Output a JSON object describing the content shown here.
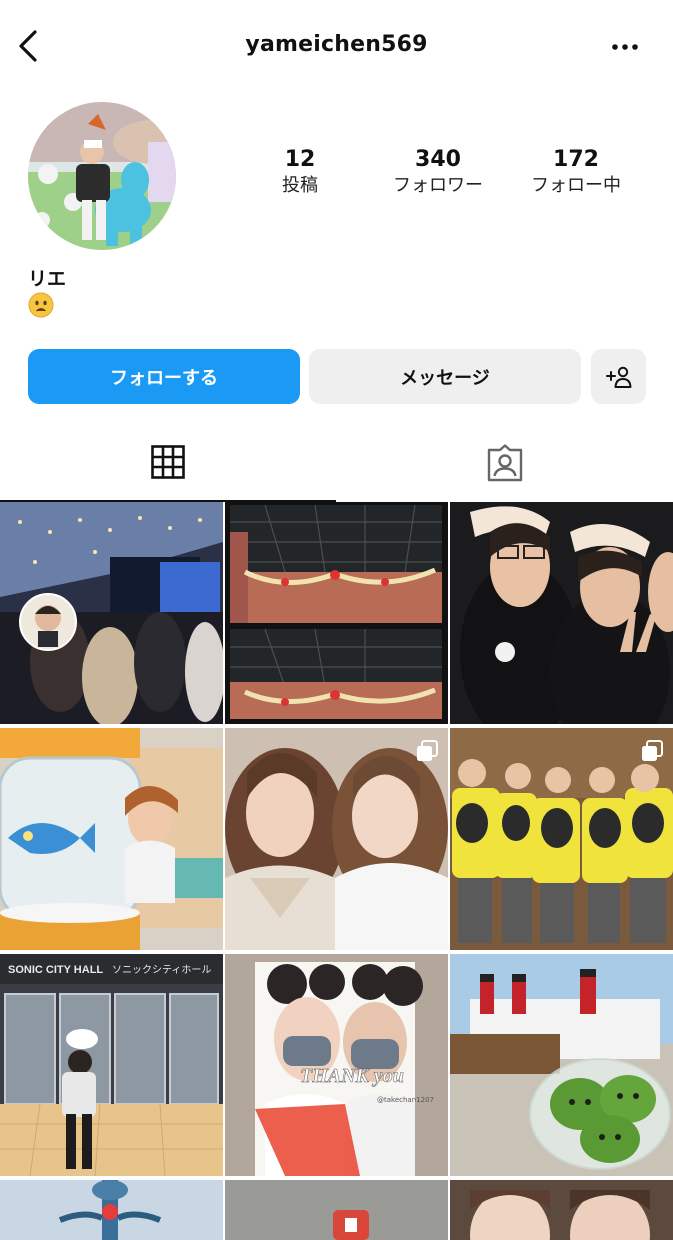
{
  "header": {
    "username": "yameichen569",
    "back_icon": "chevron-left-icon",
    "more_icon": "ellipsis-icon"
  },
  "profile": {
    "display_name": "リエ",
    "bio_emoji": "frowning-face-emoji",
    "stats": [
      {
        "key": "posts",
        "value": "12",
        "label": "投稿"
      },
      {
        "key": "followers",
        "value": "340",
        "label": "フォロワー"
      },
      {
        "key": "following",
        "value": "172",
        "label": "フォロー中"
      }
    ]
  },
  "actions": {
    "follow_label": "フォローする",
    "message_label": "メッセージ",
    "suggest_icon": "add-person-icon"
  },
  "tabs": [
    {
      "name": "posts-grid",
      "icon": "grid-icon",
      "active": true
    },
    {
      "name": "tagged",
      "icon": "tagged-person-icon",
      "active": false
    }
  ],
  "grid": {
    "tiles": [
      {
        "name": "photo-night-plaza"
      },
      {
        "name": "photo-christmas-garland-station"
      },
      {
        "name": "photo-friends-mickey-ears"
      },
      {
        "name": "photo-snow-globe-fish"
      },
      {
        "name": "photo-selfie-two-girls",
        "multi": true
      },
      {
        "name": "photo-group-yellow-shirts",
        "multi": true
      },
      {
        "name": "photo-sonic-city-hall"
      },
      {
        "name": "photo-thank-you-couple"
      },
      {
        "name": "photo-ship-green-buns"
      },
      {
        "name": "photo-partial-lamp"
      },
      {
        "name": "photo-partial-sign"
      },
      {
        "name": "photo-partial-selfie"
      }
    ],
    "thank_you_text": "THANK you",
    "sign_text": "SONIC CITY HALL",
    "sign_text_jp": "ソニックシティホール",
    "tag_text": "@takechan1207"
  },
  "colors": {
    "accent": "#1a9af5",
    "secondary_button": "#efefef"
  }
}
